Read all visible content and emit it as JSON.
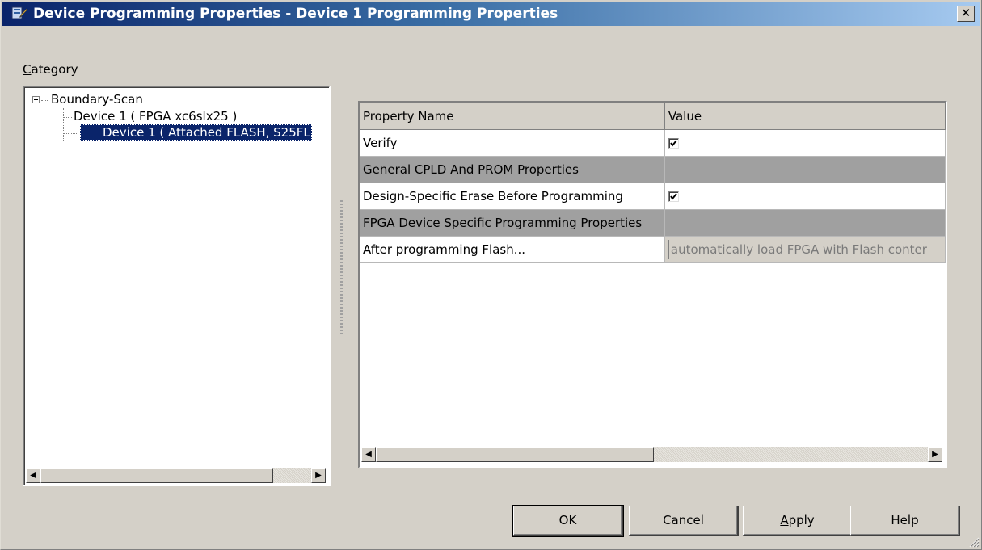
{
  "window": {
    "title": "Device Programming Properties - Device 1 Programming Properties",
    "close_glyph": "✕"
  },
  "category": {
    "label_accel": "C",
    "label_rest": "ategory"
  },
  "tree": {
    "root": "Boundary-Scan",
    "items": [
      {
        "label": "Device 1 ( FPGA xc6slx25 )",
        "selected": false
      },
      {
        "label": "Device 1 ( Attached FLASH, S25FL",
        "selected": true
      }
    ]
  },
  "grid": {
    "columns": [
      "Property Name",
      "Value"
    ],
    "rows": [
      {
        "name": "Verify",
        "type": "checkbox",
        "checked": true
      },
      {
        "name": "General CPLD And PROM Properties",
        "type": "section"
      },
      {
        "name": "Design-Specific Erase Before Programming",
        "type": "checkbox",
        "checked": true
      },
      {
        "name": "FPGA Device Specific Programming Properties",
        "type": "section"
      },
      {
        "name": "After programming Flash...",
        "type": "disabled-text",
        "value": "automatically load FPGA with Flash conter"
      }
    ]
  },
  "buttons": {
    "ok": "OK",
    "cancel": "Cancel",
    "apply_accel": "A",
    "apply_rest": "pply",
    "help": "Help"
  },
  "colors": {
    "selection": "#0a246a",
    "title_gradient_start": "#0a246a",
    "section_row": "#a0a0a0",
    "dialog_face": "#d4d0c8"
  }
}
